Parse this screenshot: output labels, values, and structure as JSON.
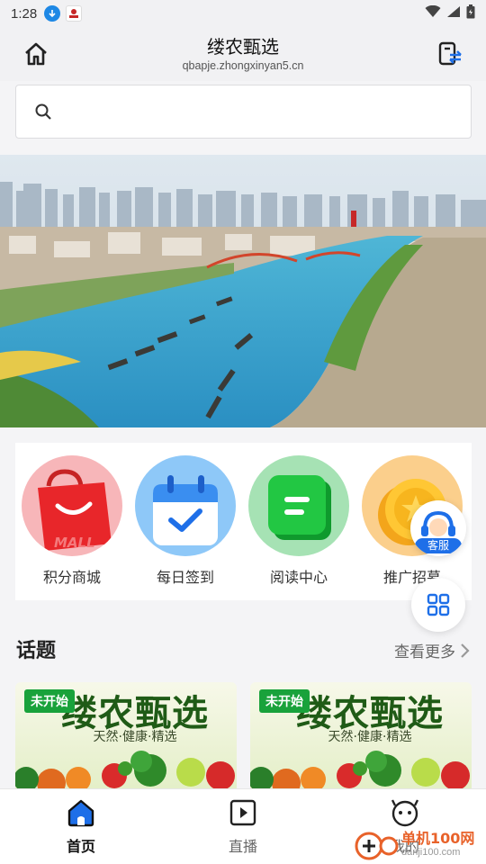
{
  "status_bar": {
    "time": "1:28"
  },
  "header": {
    "title": "缕农甄选",
    "subtitle": "qbapje.zhongxinyan5.cn"
  },
  "search": {
    "placeholder": ""
  },
  "categories": [
    {
      "label": "积分商城",
      "icon": "shopping-bag-icon",
      "bag_text": "MALL"
    },
    {
      "label": "每日签到",
      "icon": "calendar-check-icon"
    },
    {
      "label": "阅读中心",
      "icon": "document-icon"
    },
    {
      "label": "推广招募",
      "icon": "coin-icon"
    }
  ],
  "floating": {
    "service_label": "客服"
  },
  "topics": {
    "title": "话题",
    "more_label": "查看更多",
    "cards": [
      {
        "badge": "未开始",
        "brand": "缕农甄选",
        "slogan": "天然·健康·精选"
      },
      {
        "badge": "未开始",
        "brand": "缕农甄选",
        "slogan": "天然·健康·精选"
      }
    ]
  },
  "bottom_nav": [
    {
      "label": "首页",
      "icon": "home-icon",
      "active": true
    },
    {
      "label": "直播",
      "icon": "play-icon",
      "active": false
    },
    {
      "label": "我的",
      "icon": "profile-icon",
      "active": false
    }
  ],
  "watermark": {
    "text": "单机100网",
    "url": "danji100.com"
  },
  "colors": {
    "accent_green": "#19a23b",
    "brand_blue": "#1e6fe8",
    "nav_active": "#111111"
  }
}
